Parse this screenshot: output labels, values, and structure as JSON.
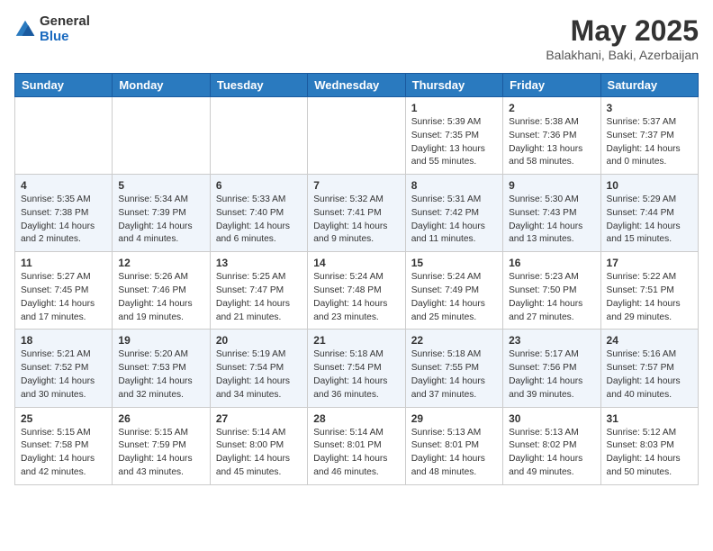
{
  "logo": {
    "general": "General",
    "blue": "Blue"
  },
  "title": "May 2025",
  "subtitle": "Balakhani, Baki, Azerbaijan",
  "days_of_week": [
    "Sunday",
    "Monday",
    "Tuesday",
    "Wednesday",
    "Thursday",
    "Friday",
    "Saturday"
  ],
  "weeks": [
    [
      {
        "day": "",
        "info": ""
      },
      {
        "day": "",
        "info": ""
      },
      {
        "day": "",
        "info": ""
      },
      {
        "day": "",
        "info": ""
      },
      {
        "day": "1",
        "info": "Sunrise: 5:39 AM\nSunset: 7:35 PM\nDaylight: 13 hours\nand 55 minutes."
      },
      {
        "day": "2",
        "info": "Sunrise: 5:38 AM\nSunset: 7:36 PM\nDaylight: 13 hours\nand 58 minutes."
      },
      {
        "day": "3",
        "info": "Sunrise: 5:37 AM\nSunset: 7:37 PM\nDaylight: 14 hours\nand 0 minutes."
      }
    ],
    [
      {
        "day": "4",
        "info": "Sunrise: 5:35 AM\nSunset: 7:38 PM\nDaylight: 14 hours\nand 2 minutes."
      },
      {
        "day": "5",
        "info": "Sunrise: 5:34 AM\nSunset: 7:39 PM\nDaylight: 14 hours\nand 4 minutes."
      },
      {
        "day": "6",
        "info": "Sunrise: 5:33 AM\nSunset: 7:40 PM\nDaylight: 14 hours\nand 6 minutes."
      },
      {
        "day": "7",
        "info": "Sunrise: 5:32 AM\nSunset: 7:41 PM\nDaylight: 14 hours\nand 9 minutes."
      },
      {
        "day": "8",
        "info": "Sunrise: 5:31 AM\nSunset: 7:42 PM\nDaylight: 14 hours\nand 11 minutes."
      },
      {
        "day": "9",
        "info": "Sunrise: 5:30 AM\nSunset: 7:43 PM\nDaylight: 14 hours\nand 13 minutes."
      },
      {
        "day": "10",
        "info": "Sunrise: 5:29 AM\nSunset: 7:44 PM\nDaylight: 14 hours\nand 15 minutes."
      }
    ],
    [
      {
        "day": "11",
        "info": "Sunrise: 5:27 AM\nSunset: 7:45 PM\nDaylight: 14 hours\nand 17 minutes."
      },
      {
        "day": "12",
        "info": "Sunrise: 5:26 AM\nSunset: 7:46 PM\nDaylight: 14 hours\nand 19 minutes."
      },
      {
        "day": "13",
        "info": "Sunrise: 5:25 AM\nSunset: 7:47 PM\nDaylight: 14 hours\nand 21 minutes."
      },
      {
        "day": "14",
        "info": "Sunrise: 5:24 AM\nSunset: 7:48 PM\nDaylight: 14 hours\nand 23 minutes."
      },
      {
        "day": "15",
        "info": "Sunrise: 5:24 AM\nSunset: 7:49 PM\nDaylight: 14 hours\nand 25 minutes."
      },
      {
        "day": "16",
        "info": "Sunrise: 5:23 AM\nSunset: 7:50 PM\nDaylight: 14 hours\nand 27 minutes."
      },
      {
        "day": "17",
        "info": "Sunrise: 5:22 AM\nSunset: 7:51 PM\nDaylight: 14 hours\nand 29 minutes."
      }
    ],
    [
      {
        "day": "18",
        "info": "Sunrise: 5:21 AM\nSunset: 7:52 PM\nDaylight: 14 hours\nand 30 minutes."
      },
      {
        "day": "19",
        "info": "Sunrise: 5:20 AM\nSunset: 7:53 PM\nDaylight: 14 hours\nand 32 minutes."
      },
      {
        "day": "20",
        "info": "Sunrise: 5:19 AM\nSunset: 7:54 PM\nDaylight: 14 hours\nand 34 minutes."
      },
      {
        "day": "21",
        "info": "Sunrise: 5:18 AM\nSunset: 7:54 PM\nDaylight: 14 hours\nand 36 minutes."
      },
      {
        "day": "22",
        "info": "Sunrise: 5:18 AM\nSunset: 7:55 PM\nDaylight: 14 hours\nand 37 minutes."
      },
      {
        "day": "23",
        "info": "Sunrise: 5:17 AM\nSunset: 7:56 PM\nDaylight: 14 hours\nand 39 minutes."
      },
      {
        "day": "24",
        "info": "Sunrise: 5:16 AM\nSunset: 7:57 PM\nDaylight: 14 hours\nand 40 minutes."
      }
    ],
    [
      {
        "day": "25",
        "info": "Sunrise: 5:15 AM\nSunset: 7:58 PM\nDaylight: 14 hours\nand 42 minutes."
      },
      {
        "day": "26",
        "info": "Sunrise: 5:15 AM\nSunset: 7:59 PM\nDaylight: 14 hours\nand 43 minutes."
      },
      {
        "day": "27",
        "info": "Sunrise: 5:14 AM\nSunset: 8:00 PM\nDaylight: 14 hours\nand 45 minutes."
      },
      {
        "day": "28",
        "info": "Sunrise: 5:14 AM\nSunset: 8:01 PM\nDaylight: 14 hours\nand 46 minutes."
      },
      {
        "day": "29",
        "info": "Sunrise: 5:13 AM\nSunset: 8:01 PM\nDaylight: 14 hours\nand 48 minutes."
      },
      {
        "day": "30",
        "info": "Sunrise: 5:13 AM\nSunset: 8:02 PM\nDaylight: 14 hours\nand 49 minutes."
      },
      {
        "day": "31",
        "info": "Sunrise: 5:12 AM\nSunset: 8:03 PM\nDaylight: 14 hours\nand 50 minutes."
      }
    ]
  ]
}
